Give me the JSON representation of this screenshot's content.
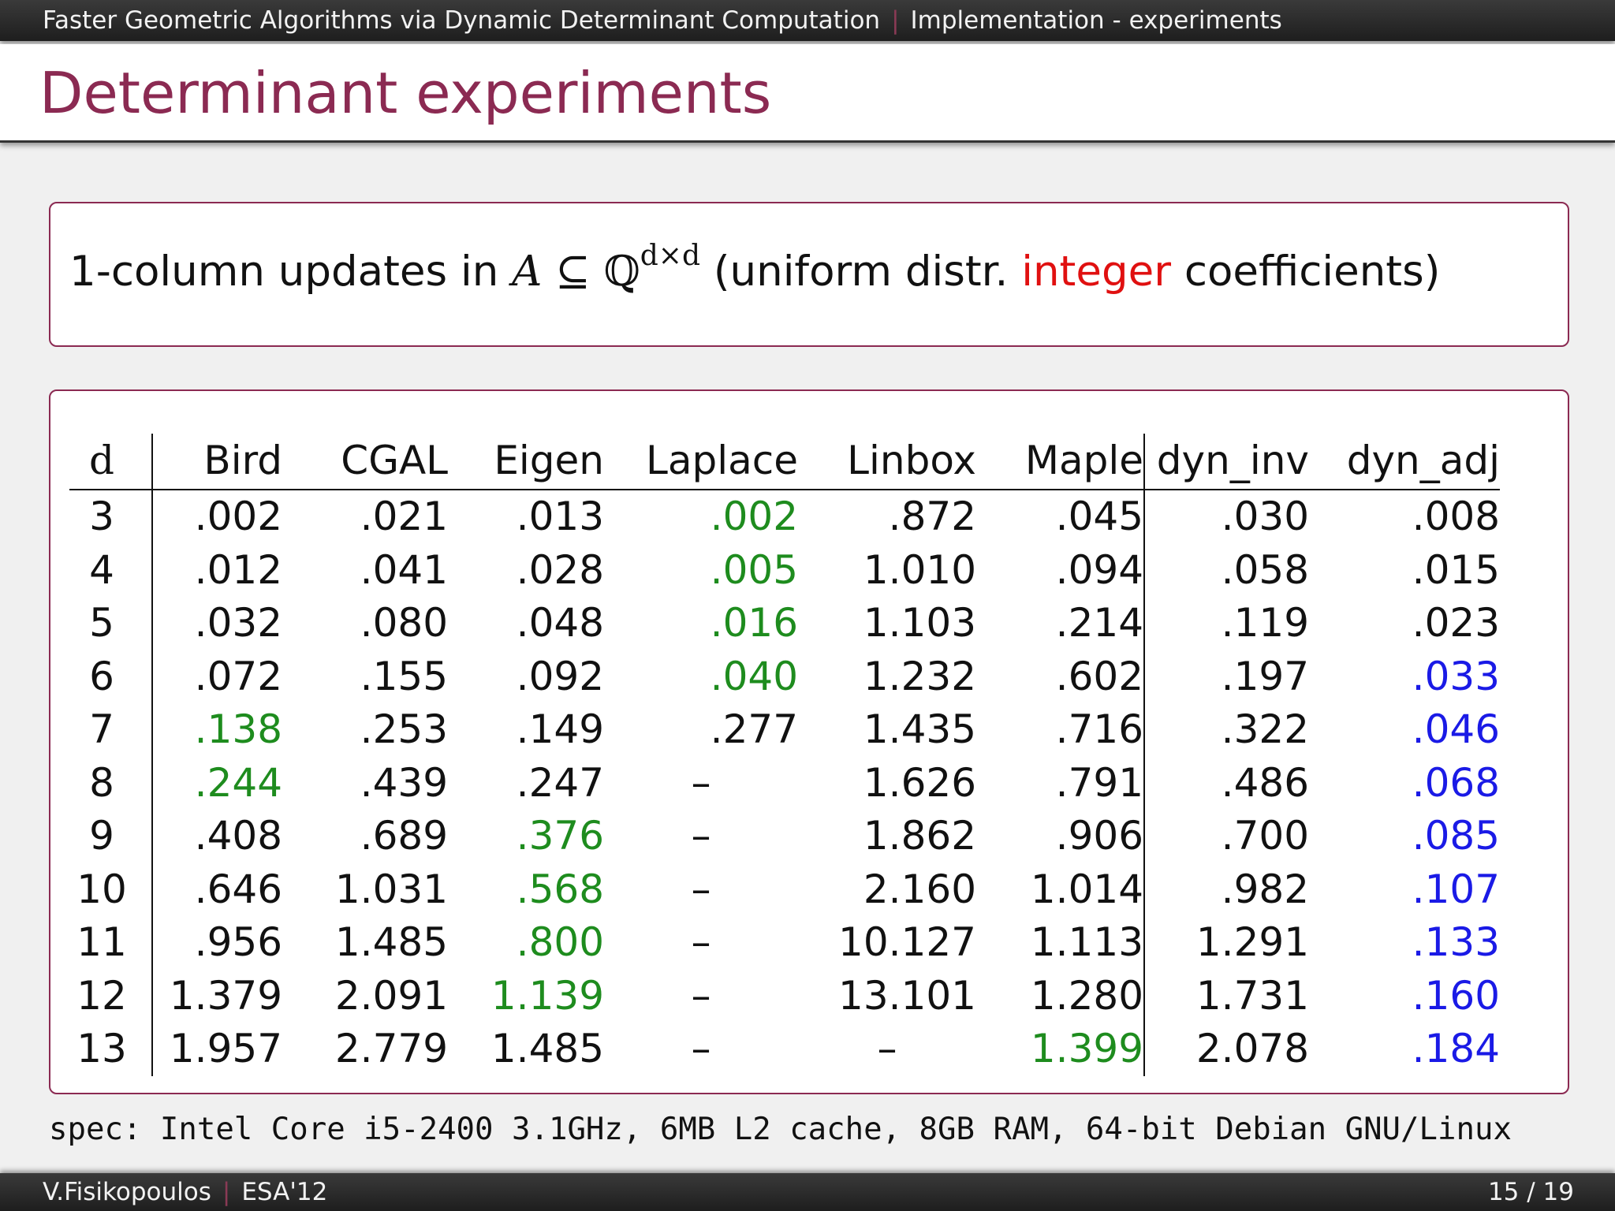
{
  "header": {
    "presentation_title": "Faster Geometric Algorithms via Dynamic Determinant Computation",
    "section": "Implementation - experiments"
  },
  "slide": {
    "title": "Determinant experiments"
  },
  "setup_box": {
    "prefix": "1-column updates in ",
    "math_var": "A",
    "subset": " ⊆ ",
    "field": "ℚ",
    "exponent": "d×d",
    "paren_open": " (uniform distr. ",
    "highlight": "integer",
    "suffix": " coefficients)"
  },
  "colors": {
    "accent": "#8b2a52",
    "best_baseline": "#1e8c1e",
    "best_dynamic": "#1a1ae6",
    "highlight": "#e01010"
  },
  "table": {
    "headers": [
      "d",
      "Bird",
      "CGAL",
      "Eigen",
      "Laplace",
      "Linbox",
      "Maple",
      "dyn_inv",
      "dyn_adj"
    ],
    "rows": [
      {
        "d": "3",
        "bird": ".002",
        "cgal": ".021",
        "eigen": ".013",
        "laplace": ".002",
        "linbox": ".872",
        "maple": ".045",
        "dyn_inv": ".030",
        "dyn_adj": ".008"
      },
      {
        "d": "4",
        "bird": ".012",
        "cgal": ".041",
        "eigen": ".028",
        "laplace": ".005",
        "linbox": "1.010",
        "maple": ".094",
        "dyn_inv": ".058",
        "dyn_adj": ".015"
      },
      {
        "d": "5",
        "bird": ".032",
        "cgal": ".080",
        "eigen": ".048",
        "laplace": ".016",
        "linbox": "1.103",
        "maple": ".214",
        "dyn_inv": ".119",
        "dyn_adj": ".023"
      },
      {
        "d": "6",
        "bird": ".072",
        "cgal": ".155",
        "eigen": ".092",
        "laplace": ".040",
        "linbox": "1.232",
        "maple": ".602",
        "dyn_inv": ".197",
        "dyn_adj": ".033"
      },
      {
        "d": "7",
        "bird": ".138",
        "cgal": ".253",
        "eigen": ".149",
        "laplace": ".277",
        "linbox": "1.435",
        "maple": ".716",
        "dyn_inv": ".322",
        "dyn_adj": ".046"
      },
      {
        "d": "8",
        "bird": ".244",
        "cgal": ".439",
        "eigen": ".247",
        "laplace": "–",
        "linbox": "1.626",
        "maple": ".791",
        "dyn_inv": ".486",
        "dyn_adj": ".068"
      },
      {
        "d": "9",
        "bird": ".408",
        "cgal": ".689",
        "eigen": ".376",
        "laplace": "–",
        "linbox": "1.862",
        "maple": ".906",
        "dyn_inv": ".700",
        "dyn_adj": ".085"
      },
      {
        "d": "10",
        "bird": ".646",
        "cgal": "1.031",
        "eigen": ".568",
        "laplace": "–",
        "linbox": "2.160",
        "maple": "1.014",
        "dyn_inv": ".982",
        "dyn_adj": ".107"
      },
      {
        "d": "11",
        "bird": ".956",
        "cgal": "1.485",
        "eigen": ".800",
        "laplace": "–",
        "linbox": "10.127",
        "maple": "1.113",
        "dyn_inv": "1.291",
        "dyn_adj": ".133"
      },
      {
        "d": "12",
        "bird": "1.379",
        "cgal": "2.091",
        "eigen": "1.139",
        "laplace": "–",
        "linbox": "13.101",
        "maple": "1.280",
        "dyn_inv": "1.731",
        "dyn_adj": ".160"
      },
      {
        "d": "13",
        "bird": "1.957",
        "cgal": "2.779",
        "eigen": "1.485",
        "laplace": "–",
        "linbox": "–",
        "maple": "1.399",
        "dyn_inv": "2.078",
        "dyn_adj": ".184"
      }
    ],
    "highlighted_best_baseline": [
      {
        "d": "3",
        "column": "laplace"
      },
      {
        "d": "4",
        "column": "laplace"
      },
      {
        "d": "5",
        "column": "laplace"
      },
      {
        "d": "6",
        "column": "laplace"
      },
      {
        "d": "7",
        "column": "bird"
      },
      {
        "d": "8",
        "column": "bird"
      },
      {
        "d": "9",
        "column": "eigen"
      },
      {
        "d": "10",
        "column": "eigen"
      },
      {
        "d": "11",
        "column": "eigen"
      },
      {
        "d": "12",
        "column": "eigen"
      },
      {
        "d": "13",
        "column": "maple"
      }
    ],
    "highlighted_best_dynamic": [
      {
        "d": "6",
        "column": "dyn_adj"
      },
      {
        "d": "7",
        "column": "dyn_adj"
      },
      {
        "d": "8",
        "column": "dyn_adj"
      },
      {
        "d": "9",
        "column": "dyn_adj"
      },
      {
        "d": "10",
        "column": "dyn_adj"
      },
      {
        "d": "11",
        "column": "dyn_adj"
      },
      {
        "d": "12",
        "column": "dyn_adj"
      },
      {
        "d": "13",
        "column": "dyn_adj"
      }
    ]
  },
  "spec": "spec:  Intel Core i5-2400 3.1GHz, 6MB L2 cache, 8GB RAM, 64-bit Debian GNU/Linux",
  "footer": {
    "author": "V.Fisikopoulos",
    "venue": "ESA'12",
    "page": "15 / 19"
  }
}
